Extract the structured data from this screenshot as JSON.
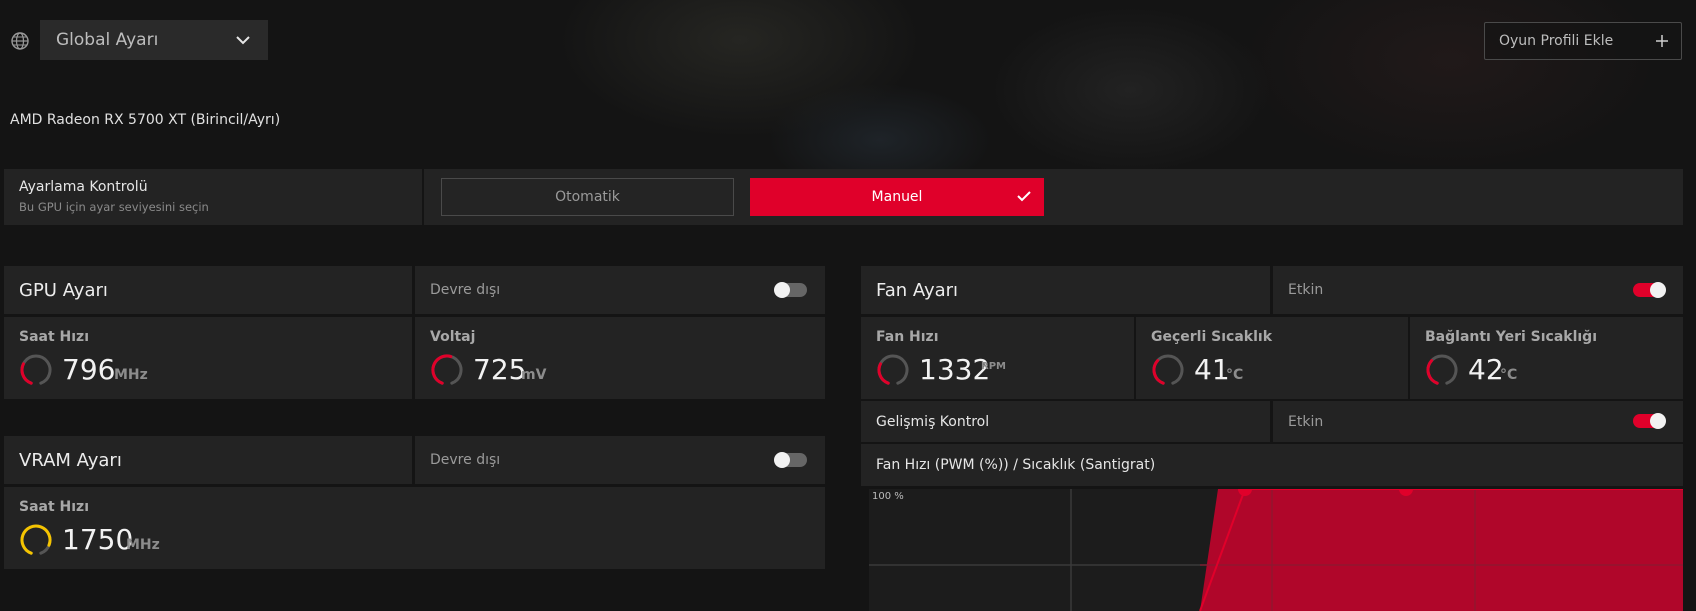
{
  "header": {
    "profile_select": "Global Ayarı",
    "add_profile": "Oyun Profili Ekle"
  },
  "gpu_name": "AMD Radeon RX 5700 XT (Birincil/Ayrı)",
  "tuning_control": {
    "title": "Ayarlama Kontrolü",
    "subtitle": "Bu GPU için ayar seviyesini seçin",
    "option_auto": "Otomatik",
    "option_manual": "Manuel",
    "selected": "Manuel"
  },
  "gpu_tuning": {
    "title": "GPU Ayarı",
    "state": "Devre dışı",
    "enabled": false,
    "clock": {
      "label": "Saat Hızı",
      "value": "796",
      "unit": "MHz",
      "fraction": 0.3
    },
    "voltage": {
      "label": "Voltaj",
      "value": "725",
      "unit": "mV",
      "fraction": 0.55
    }
  },
  "vram_tuning": {
    "title": "VRAM Ayarı",
    "state": "Devre dışı",
    "enabled": false,
    "clock": {
      "label": "Saat Hızı",
      "value": "1750",
      "unit": "MHz",
      "fraction": 0.85
    }
  },
  "fan_tuning": {
    "title": "Fan Ayarı",
    "state": "Etkin",
    "enabled": true,
    "fan_speed": {
      "label": "Fan Hızı",
      "value": "1332",
      "unit": "RPM",
      "fraction": 0.3
    },
    "current_temp": {
      "label": "Geçerli Sıcaklık",
      "value": "41",
      "unit": "°C",
      "fraction": 0.35
    },
    "junction_temp": {
      "label": "Bağlantı Yeri Sıcaklığı",
      "value": "42",
      "unit": "°C",
      "fraction": 0.35
    },
    "advanced": {
      "label": "Gelişmiş Kontrol",
      "state": "Etkin",
      "enabled": true
    },
    "curve_title": "Fan Hızı (PWM (%)) / Sıcaklık (Santigrat)",
    "curve_y_label": "100 %"
  },
  "colors": {
    "accent": "#e0002a",
    "gauge_yellow": "#f5c400",
    "panel": "#232323",
    "background": "#141414"
  }
}
